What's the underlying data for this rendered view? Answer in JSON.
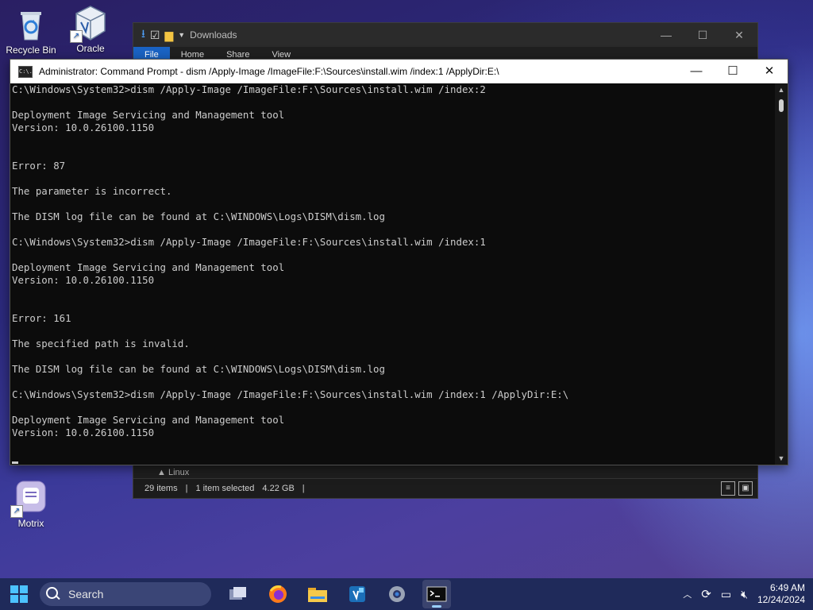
{
  "desktop": {
    "icons": [
      {
        "label": "Recycle Bin"
      },
      {
        "label": "Oracle"
      },
      {
        "label": "Motrix"
      }
    ]
  },
  "explorer": {
    "title": "Downloads",
    "tabs": [
      "File",
      "Home",
      "Share",
      "View"
    ],
    "nav_item": "Linux",
    "status": {
      "items": "29 items",
      "selected": "1 item selected",
      "size": "4.22 GB"
    }
  },
  "cmd": {
    "title": "Administrator: Command Prompt - dism  /Apply-Image /ImageFile:F:\\Sources\\install.wim /index:1 /ApplyDir:E:\\",
    "icon_text": "C:\\.",
    "lines": [
      "C:\\Windows\\System32>dism /Apply-Image /ImageFile:F:\\Sources\\install.wim /index:2",
      "",
      "Deployment Image Servicing and Management tool",
      "Version: 10.0.26100.1150",
      "",
      "",
      "Error: 87",
      "",
      "The parameter is incorrect.",
      "",
      "The DISM log file can be found at C:\\WINDOWS\\Logs\\DISM\\dism.log",
      "",
      "C:\\Windows\\System32>dism /Apply-Image /ImageFile:F:\\Sources\\install.wim /index:1",
      "",
      "Deployment Image Servicing and Management tool",
      "Version: 10.0.26100.1150",
      "",
      "",
      "Error: 161",
      "",
      "The specified path is invalid.",
      "",
      "The DISM log file can be found at C:\\WINDOWS\\Logs\\DISM\\dism.log",
      "",
      "C:\\Windows\\System32>dism /Apply-Image /ImageFile:F:\\Sources\\install.wim /index:1 /ApplyDir:E:\\",
      "",
      "Deployment Image Servicing and Management tool",
      "Version: 10.0.26100.1150",
      ""
    ]
  },
  "taskbar": {
    "search_label": "Search",
    "apps": [
      "task-view-icon",
      "firefox-icon",
      "file-explorer-icon",
      "virtualbox-icon",
      "settings-icon",
      "terminal-icon"
    ],
    "clock": {
      "time": "6:49 AM",
      "date": "12/24/2024"
    }
  },
  "colors": {
    "accent": "#1a63c4",
    "terminal_bg": "#0c0c0c",
    "terminal_fg": "#cccccc"
  }
}
